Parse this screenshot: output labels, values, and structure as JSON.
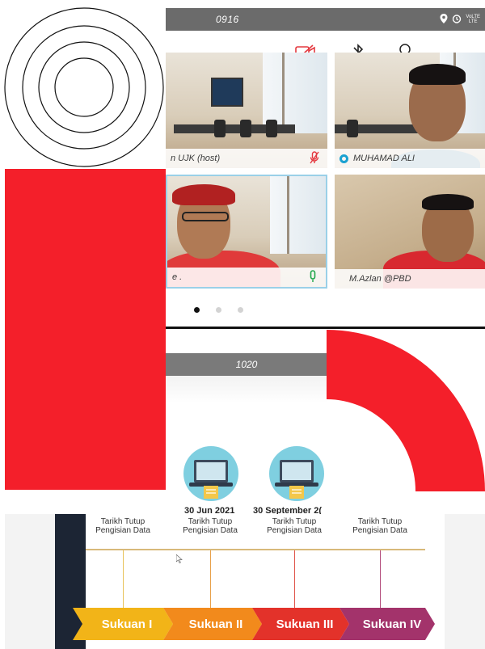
{
  "status_bar": {
    "time": "0916",
    "icons": [
      "location-icon",
      "alarm-icon",
      "network-icon"
    ],
    "network_text_top": "VoLTE",
    "network_text_bottom": "LTE"
  },
  "toolbar": {
    "buttons": [
      "video-off-icon",
      "bluetooth-icon",
      "participants-icon",
      "more-icon"
    ],
    "more_label": "···"
  },
  "tiles": [
    {
      "name": "n UJK (host)",
      "mic": "muted"
    },
    {
      "name": "MUHAMAD ALI",
      "mic": "none"
    },
    {
      "name": "e .",
      "mic": "active"
    },
    {
      "name": "M.Azlan @PBD",
      "mic": "none"
    }
  ],
  "pager": {
    "count": 3,
    "active": 0
  },
  "status_bar_2": {
    "time": "1020"
  },
  "slide": {
    "dates": [
      "30 Jun 2021",
      "30 September 2("
    ],
    "column_labels": [
      "Tarikh Tutup Pengisian Data",
      "Tarikh Tutup Pengisian Data",
      "Tarikh Tutup Pengisian Data",
      "Tarikh Tutup Pengisian Data"
    ],
    "stages": [
      "Sukuan I",
      "Sukuan II",
      "Sukuan III",
      "Sukuan IV"
    ]
  },
  "colors": {
    "red": "#f41f2a",
    "stage1": "#f2b418",
    "stage2": "#f28a1c",
    "stage3": "#e3322a",
    "stage4": "#a3336b",
    "accent_blue": "#1aa1d1",
    "mic_green": "#1fa64a"
  }
}
